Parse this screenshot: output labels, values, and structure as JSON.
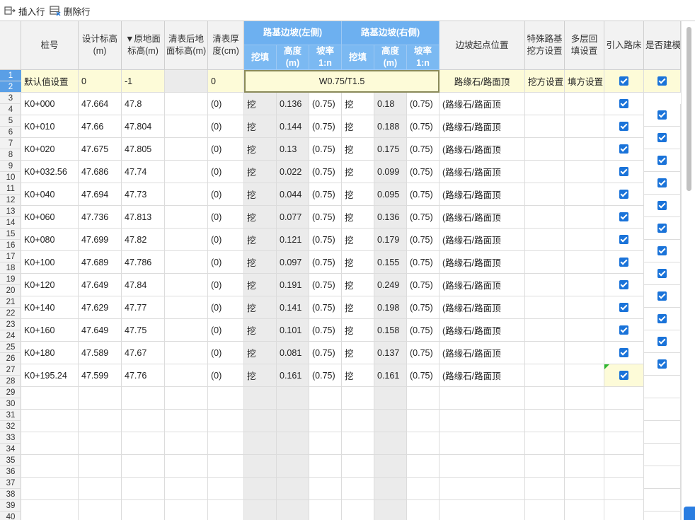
{
  "toolbar": {
    "insert_label": "插入行",
    "delete_label": "删除行"
  },
  "header": {
    "stake": "桩号",
    "design_elev": "设计标高(m)",
    "ground_elev": "▼原地面标高(m)",
    "cleared_elev": "清表后地面标高(m)",
    "clear_thickness": "清表厚度(cm)",
    "left_slope": "路基边坡(左侧)",
    "right_slope": "路基边坡(右侧)",
    "cutfill": "挖填",
    "height": "高度(m)",
    "ratio": "坡率1:n",
    "slope_start": "边坡起点位置",
    "special": "特殊路基挖方设置",
    "multilayer": "多层回填设置",
    "into_bed": "引入路床",
    "modeling": "是否建模"
  },
  "default_row": {
    "label": "默认值设置",
    "design": "0",
    "ground": "-1",
    "thickness": "0",
    "slope_summary": "W0.75/T1.5",
    "slope_start": "路缘石/路面顶",
    "special": "挖方设置",
    "multilayer": "填方设置"
  },
  "row_numbers": [
    "1",
    "2",
    "3",
    "4",
    "5",
    "6",
    "7",
    "8",
    "9",
    "10",
    "11",
    "12",
    "13",
    "14",
    "15",
    "16",
    "17",
    "18",
    "19",
    "20",
    "21",
    "22",
    "23",
    "24",
    "25",
    "26",
    "27",
    "28",
    "29",
    "30",
    "31",
    "32",
    "33",
    "34",
    "35",
    "36",
    "37",
    "38",
    "39",
    "40"
  ],
  "rows": [
    {
      "stake": "K0+000",
      "design": "47.664",
      "ground": "47.8",
      "thickness": "(0)",
      "lcf": "挖",
      "lh": "0.136",
      "lr": "(0.75)",
      "rcf": "挖",
      "rh": "0.18",
      "rr": "(0.75)",
      "start": "(路缘石/路面顶"
    },
    {
      "stake": "K0+010",
      "design": "47.66",
      "ground": "47.804",
      "thickness": "(0)",
      "lcf": "挖",
      "lh": "0.144",
      "lr": "(0.75)",
      "rcf": "挖",
      "rh": "0.188",
      "rr": "(0.75)",
      "start": "(路缘石/路面顶"
    },
    {
      "stake": "K0+020",
      "design": "47.675",
      "ground": "47.805",
      "thickness": "(0)",
      "lcf": "挖",
      "lh": "0.13",
      "lr": "(0.75)",
      "rcf": "挖",
      "rh": "0.175",
      "rr": "(0.75)",
      "start": "(路缘石/路面顶"
    },
    {
      "stake": "K0+032.56",
      "design": "47.686",
      "ground": "47.74",
      "thickness": "(0)",
      "lcf": "挖",
      "lh": "0.022",
      "lr": "(0.75)",
      "rcf": "挖",
      "rh": "0.099",
      "rr": "(0.75)",
      "start": "(路缘石/路面顶"
    },
    {
      "stake": "K0+040",
      "design": "47.694",
      "ground": "47.73",
      "thickness": "(0)",
      "lcf": "挖",
      "lh": "0.044",
      "lr": "(0.75)",
      "rcf": "挖",
      "rh": "0.095",
      "rr": "(0.75)",
      "start": "(路缘石/路面顶"
    },
    {
      "stake": "K0+060",
      "design": "47.736",
      "ground": "47.813",
      "thickness": "(0)",
      "lcf": "挖",
      "lh": "0.077",
      "lr": "(0.75)",
      "rcf": "挖",
      "rh": "0.136",
      "rr": "(0.75)",
      "start": "(路缘石/路面顶"
    },
    {
      "stake": "K0+080",
      "design": "47.699",
      "ground": "47.82",
      "thickness": "(0)",
      "lcf": "挖",
      "lh": "0.121",
      "lr": "(0.75)",
      "rcf": "挖",
      "rh": "0.179",
      "rr": "(0.75)",
      "start": "(路缘石/路面顶"
    },
    {
      "stake": "K0+100",
      "design": "47.689",
      "ground": "47.786",
      "thickness": "(0)",
      "lcf": "挖",
      "lh": "0.097",
      "lr": "(0.75)",
      "rcf": "挖",
      "rh": "0.155",
      "rr": "(0.75)",
      "start": "(路缘石/路面顶"
    },
    {
      "stake": "K0+120",
      "design": "47.649",
      "ground": "47.84",
      "thickness": "(0)",
      "lcf": "挖",
      "lh": "0.191",
      "lr": "(0.75)",
      "rcf": "挖",
      "rh": "0.249",
      "rr": "(0.75)",
      "start": "(路缘石/路面顶"
    },
    {
      "stake": "K0+140",
      "design": "47.629",
      "ground": "47.77",
      "thickness": "(0)",
      "lcf": "挖",
      "lh": "0.141",
      "lr": "(0.75)",
      "rcf": "挖",
      "rh": "0.198",
      "rr": "(0.75)",
      "start": "(路缘石/路面顶"
    },
    {
      "stake": "K0+160",
      "design": "47.649",
      "ground": "47.75",
      "thickness": "(0)",
      "lcf": "挖",
      "lh": "0.101",
      "lr": "(0.75)",
      "rcf": "挖",
      "rh": "0.158",
      "rr": "(0.75)",
      "start": "(路缘石/路面顶"
    },
    {
      "stake": "K0+180",
      "design": "47.589",
      "ground": "47.67",
      "thickness": "(0)",
      "lcf": "挖",
      "lh": "0.081",
      "lr": "(0.75)",
      "rcf": "挖",
      "rh": "0.137",
      "rr": "(0.75)",
      "start": "(路缘石/路面顶"
    },
    {
      "stake": "K0+195.24",
      "design": "47.599",
      "ground": "47.76",
      "thickness": "(0)",
      "lcf": "挖",
      "lh": "0.161",
      "lr": "(0.75)",
      "rcf": "挖",
      "rh": "0.161",
      "rr": "(0.75)",
      "start": "(路缘石/路面顶"
    }
  ],
  "colors": {
    "header_blue": "#6db0f0",
    "checkbox_blue": "#1a73d9",
    "default_row_yellow": "#fdfbd8",
    "grey_column": "#ebebeb",
    "selected_row_number": "#5a9fe6"
  }
}
